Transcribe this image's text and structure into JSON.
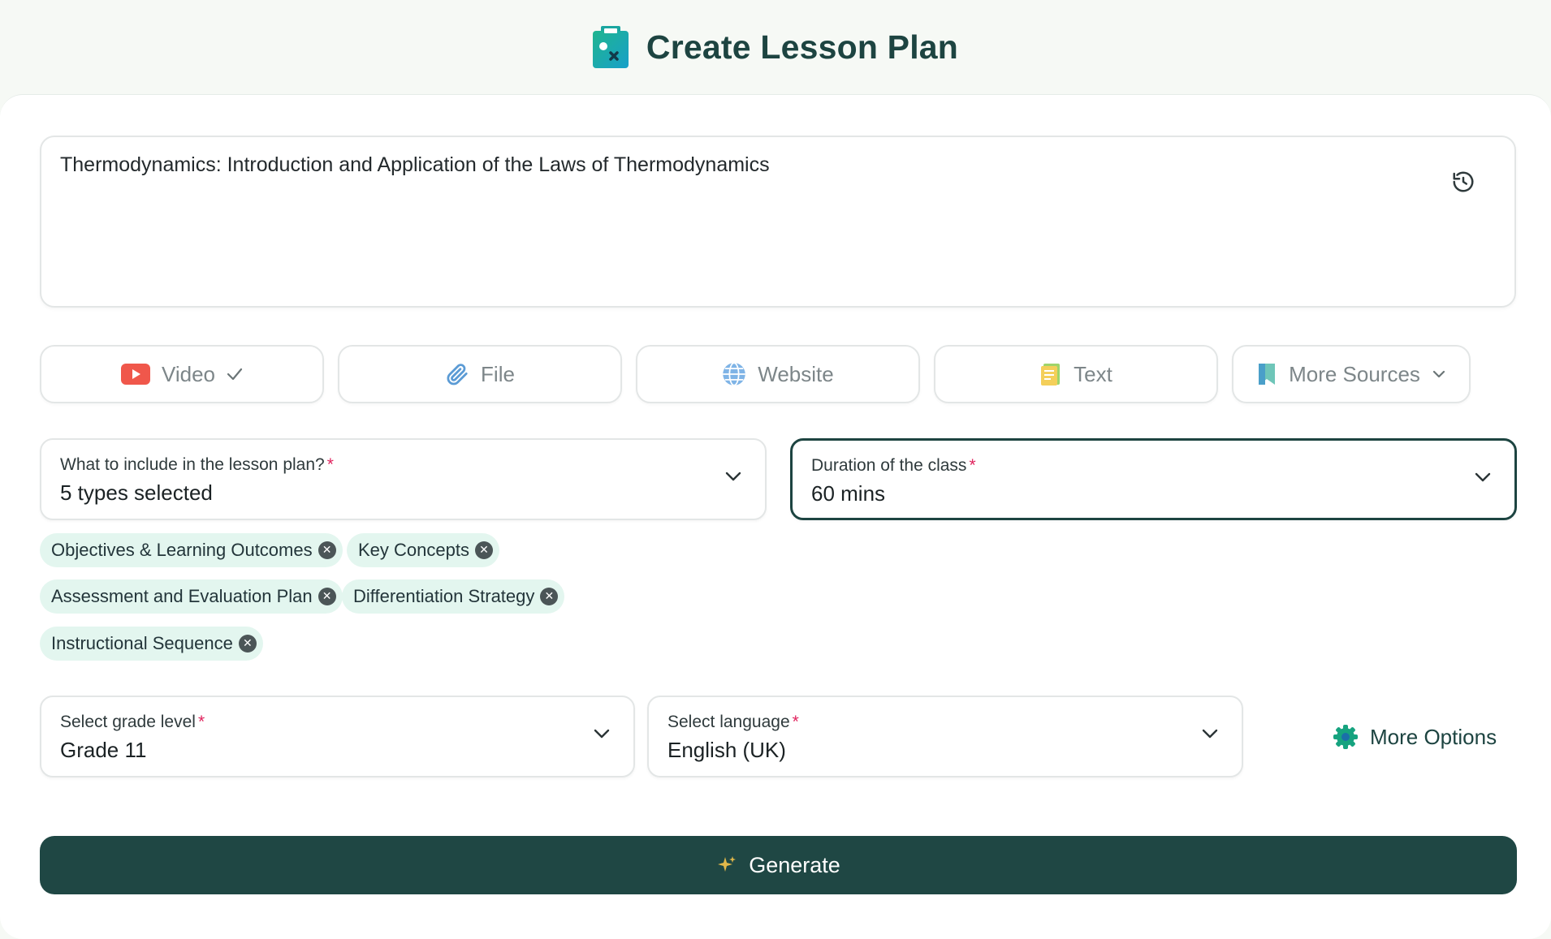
{
  "header": {
    "title": "Create Lesson Plan",
    "logo_icon": "lesson-plan-clipboard-icon"
  },
  "topic": {
    "value": "Thermodynamics: Introduction and Application of the Laws of Thermodynamics",
    "history_icon": "history-icon"
  },
  "sources": [
    {
      "label": "Video",
      "icon": "youtube-icon",
      "checked": true
    },
    {
      "label": "File",
      "icon": "paperclip-icon"
    },
    {
      "label": "Website",
      "icon": "globe-icon"
    },
    {
      "label": "Text",
      "icon": "text-document-icon"
    },
    {
      "label": "More Sources",
      "icon": "bookmark-icon"
    }
  ],
  "include_field": {
    "label": "What to include in the lesson plan?",
    "required_mark": "*",
    "value": "5 types selected"
  },
  "duration_field": {
    "label": "Duration of the class",
    "required_mark": "*",
    "value": "60 mins"
  },
  "chips": [
    "Objectives & Learning Outcomes",
    "Key Concepts",
    "Assessment and Evaluation Plan",
    "Differentiation Strategy",
    "Instructional Sequence"
  ],
  "grade_field": {
    "label": "Select grade level",
    "required_mark": "*",
    "value": "Grade 11"
  },
  "language_field": {
    "label": "Select language",
    "required_mark": "*",
    "value": "English (UK)"
  },
  "more_options": {
    "label": "More Options",
    "icon": "gear-icon"
  },
  "generate": {
    "label": "Generate",
    "icon": "sparkle-icon"
  },
  "colors": {
    "brand": "#1f4744",
    "chip_bg": "#e3f6ef",
    "required": "#e0245e",
    "page_bg": "#f6f9f5"
  }
}
